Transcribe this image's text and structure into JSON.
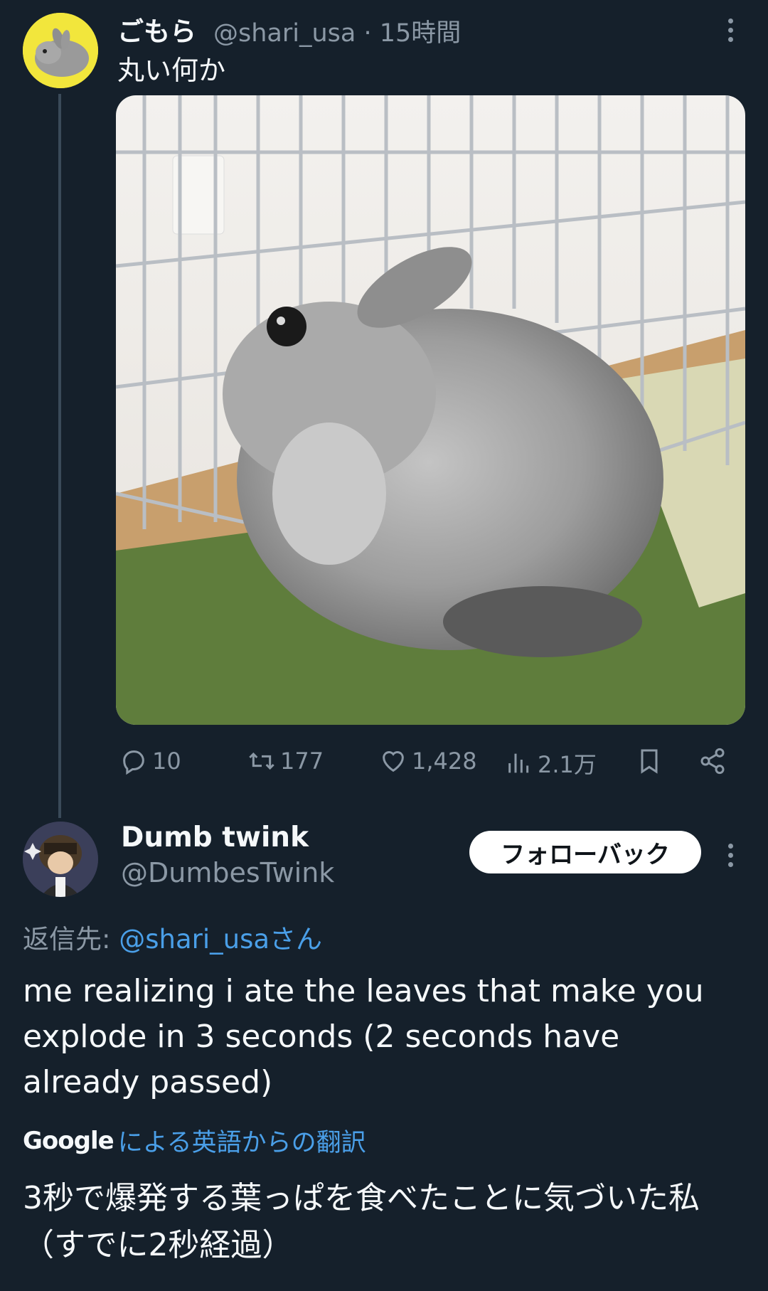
{
  "tweet": {
    "author_name": "ごもら",
    "meta": "@shari_usa · 15時間",
    "text": "丸い何か",
    "stats": {
      "replies": "10",
      "retweets": "177",
      "likes": "1,428",
      "views": "2.1万"
    }
  },
  "reply": {
    "author_name": "Dumb twink",
    "handle": "@DumbesTwink",
    "follow_button": "フォローバック",
    "reply_to_prefix": "返信先: ",
    "reply_to_handle": "@shari_usaさん",
    "text": "me realizing i ate the leaves that make you explode in 3 seconds (2 seconds have already passed)",
    "translation_source": "Google",
    "translation_label": "による英語からの翻訳",
    "translated_text": "3秒で爆発する葉っぱを食べたことに気づいた私（すでに2秒経過）"
  },
  "icons": [
    "more-icon",
    "reply-icon",
    "retweet-icon",
    "like-icon",
    "views-icon",
    "bookmark-icon",
    "share-icon"
  ],
  "colors": {
    "background": "#15202b",
    "text": "#f5f8fa",
    "secondary": "#8b98a5",
    "link": "#4a9fe8",
    "avatar_bg": "#f2e63c"
  }
}
